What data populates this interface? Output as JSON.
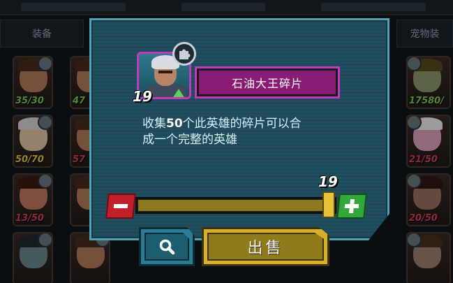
{
  "colors": {
    "dialog_bg": "#1d4a5a",
    "dialog_border": "#4fa2b6",
    "rarity_purple": "#c23ab8",
    "sell_gold": "#d6b02a",
    "minus_red": "#c1202a",
    "plus_green": "#32a83a"
  },
  "background": {
    "tabs": [
      "装备",
      "宠物装"
    ],
    "left_cards": [
      {
        "count": "35/30",
        "color": "green"
      },
      {
        "count": "50/70",
        "color": "yellow"
      },
      {
        "count": "13/50",
        "color": "red"
      },
      {
        "count": "",
        "color": "red"
      }
    ],
    "left_cards_col2": [
      {
        "count": "47",
        "color": "green"
      },
      {
        "count": "57",
        "color": "red"
      },
      {
        "count": "",
        "color": "red"
      },
      {
        "count": "",
        "color": "red"
      }
    ],
    "right_cards": [
      {
        "count": "17580/",
        "color": "green"
      },
      {
        "count": "21/50",
        "color": "red"
      },
      {
        "count": "20/50",
        "color": "red"
      },
      {
        "count": "",
        "color": "red"
      }
    ]
  },
  "dialog": {
    "hero_level": "19",
    "hero_icon": "hero-portrait",
    "fragment_name": "石油大王碎片",
    "description_prefix": "收集",
    "description_number": "50",
    "description_line1_rest": "个此英雄的碎片可以合",
    "description_line2": "成一个完整的英雄",
    "slider": {
      "selected_qty": "19",
      "max_qty": 19,
      "fill_fraction": 1.0
    },
    "sell_label": "出售",
    "search_icon": "magnifier-icon",
    "minus_icon": "minus-icon",
    "plus_icon": "plus-icon",
    "badge_icon": "puzzle-piece-icon"
  }
}
